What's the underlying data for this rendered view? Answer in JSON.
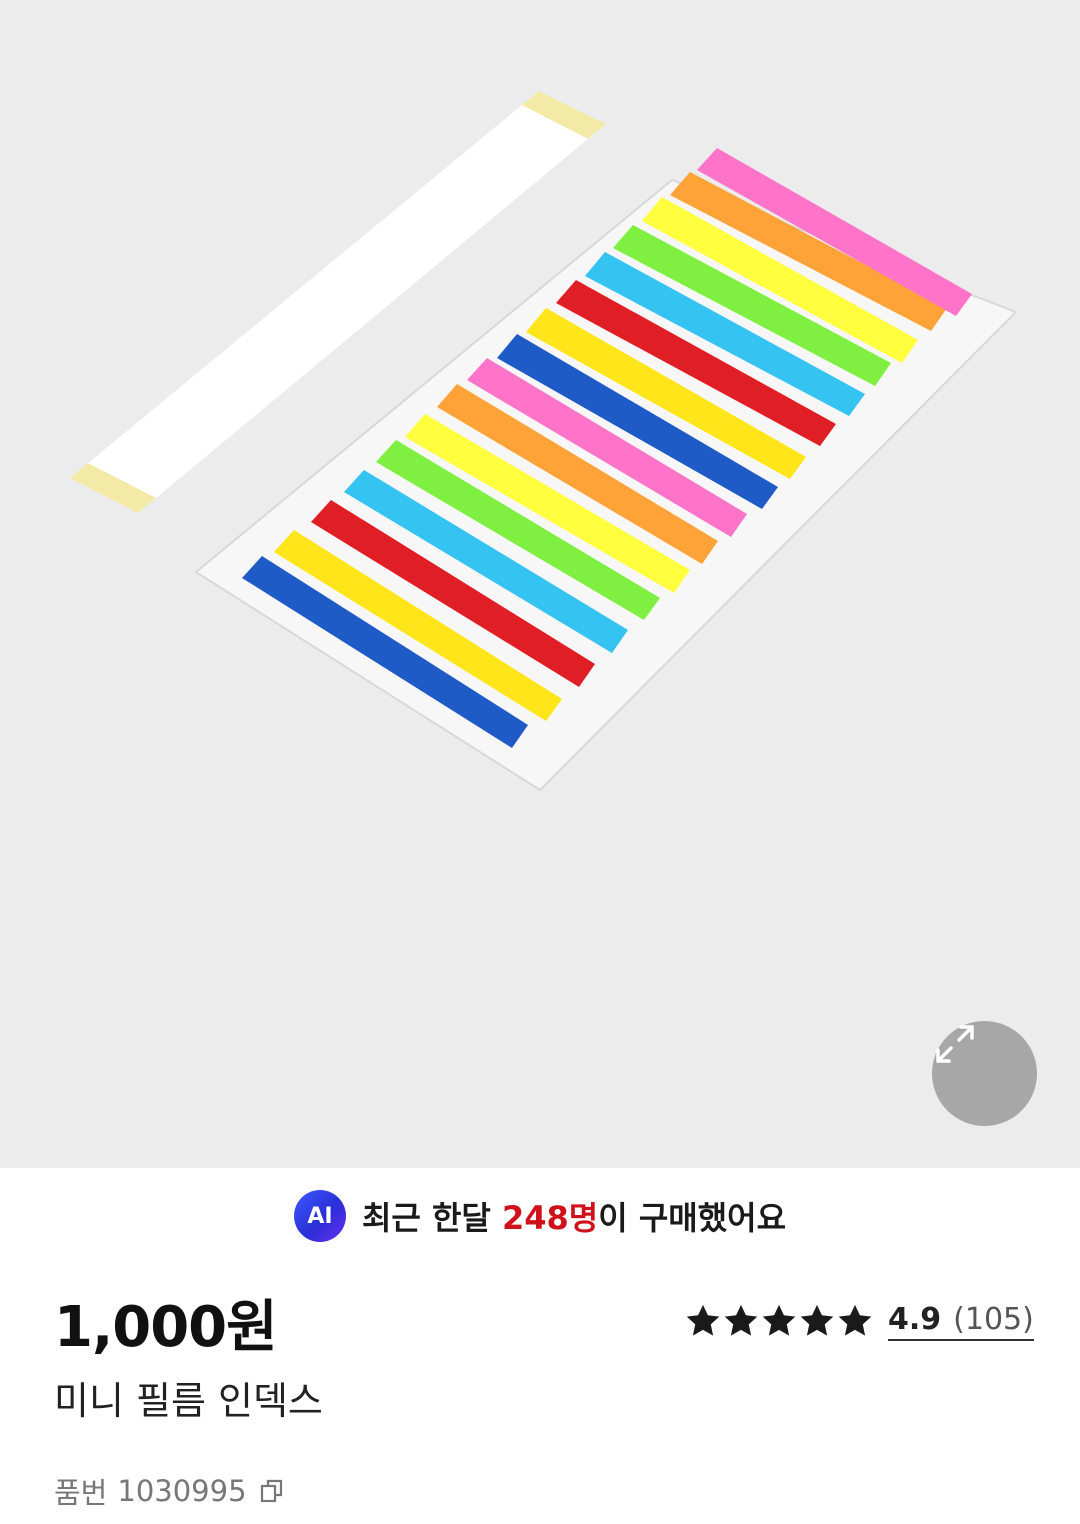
{
  "product": {
    "image_alt": "미니 필름 인덱스",
    "ai_badge": "AI",
    "ai_prefix": "최근 한달 ",
    "ai_count": "248명",
    "ai_suffix": "이 구매했어요",
    "price": "1,000원",
    "rating": "4.9",
    "review_count": "(105)",
    "name": "미니 필름 인덱스",
    "sku_label": "품번",
    "sku_value": "1030995"
  },
  "icons": {
    "expand": "expand-arrows-icon",
    "star": "star-icon",
    "copy": "copy-icon"
  },
  "colors": {
    "sale_highlight": "#d0111b",
    "ai_badge": "#3f5bff",
    "hero_background": "#ececed"
  }
}
